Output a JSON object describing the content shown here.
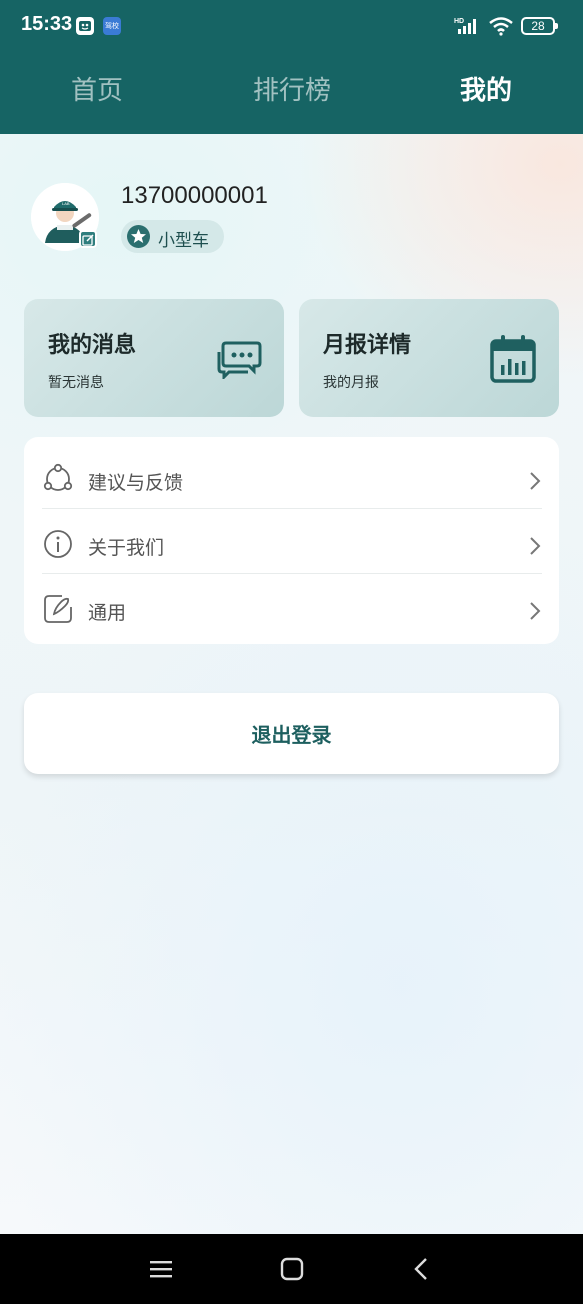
{
  "status_bar": {
    "time": "15:33",
    "battery": "28",
    "notif2_text": "驾校"
  },
  "tabs": [
    {
      "label": "首页",
      "active": false
    },
    {
      "label": "排行榜",
      "active": false
    },
    {
      "label": "我的",
      "active": true
    }
  ],
  "profile": {
    "phone": "13700000001",
    "vehicle_badge": "小型车"
  },
  "cards": {
    "messages": {
      "title": "我的消息",
      "subtitle": "暂无消息",
      "icon": "chat-bubbles-icon"
    },
    "report": {
      "title": "月报详情",
      "subtitle": "我的月报",
      "icon": "calendar-icon"
    }
  },
  "menu": [
    {
      "label": "建议与反馈",
      "icon": "feedback-icon"
    },
    {
      "label": "关于我们",
      "icon": "info-icon"
    },
    {
      "label": "通用",
      "icon": "edit-icon"
    }
  ],
  "logout_label": "退出登录",
  "colors": {
    "primary": "#166464",
    "card": "#c7dfdf",
    "accent_text": "#1d5f5f"
  }
}
